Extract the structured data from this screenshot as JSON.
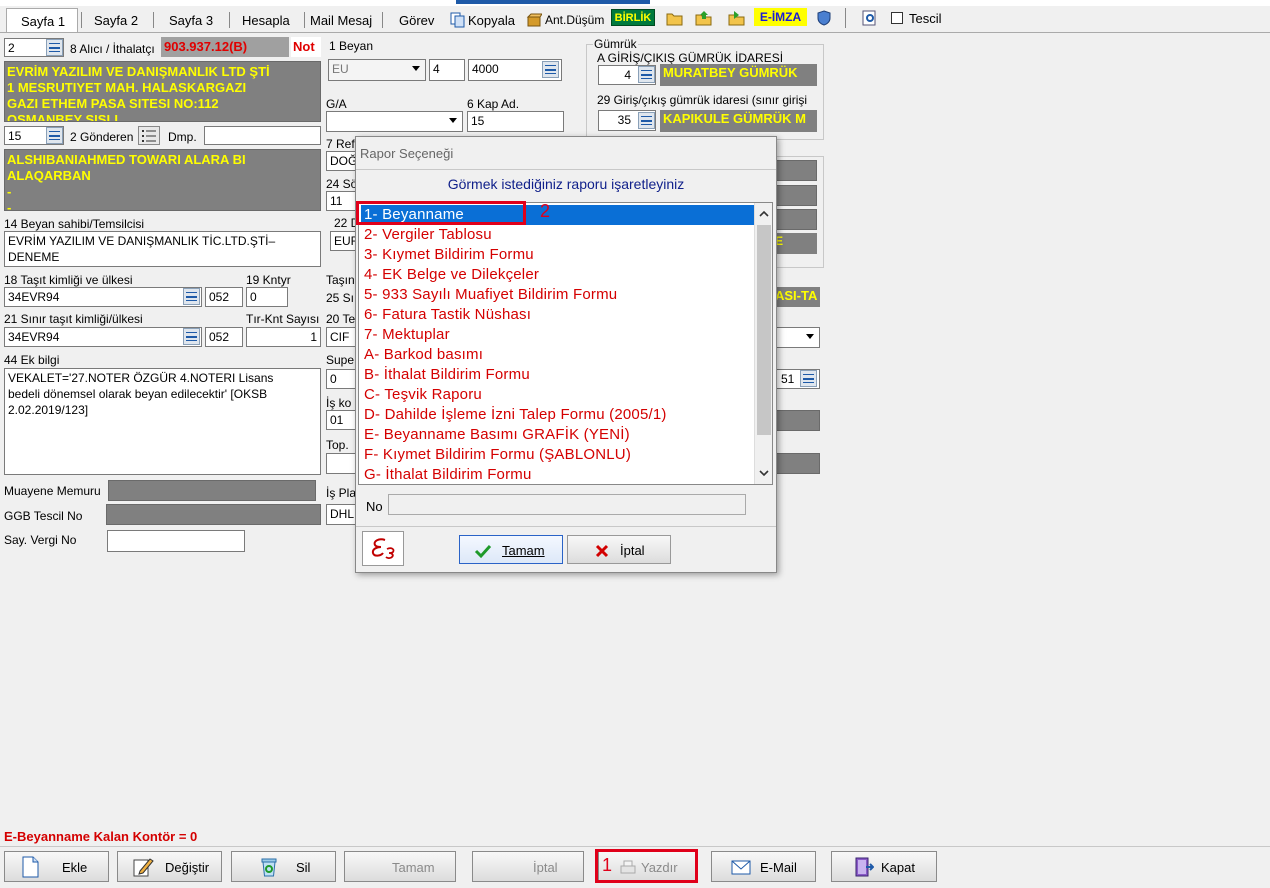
{
  "tabs": {
    "sayfa1": "Sayfa 1",
    "sayfa2": "Sayfa 2",
    "sayfa3": "Sayfa 3",
    "hesapla": "Hesapla",
    "mail": "Mail Mesaj",
    "gorev": "Görev",
    "kopyala": "Kopyala",
    "ant": "Ant.Düşüm",
    "birlik": "BİRLİK",
    "eimza": "E-İMZA",
    "tescil": "Tescil"
  },
  "left": {
    "alici_no": "2",
    "alici_label": "8 Alıcı / İthalatçı",
    "alici_code": "903.937.12(B)",
    "not_label": "Not",
    "alici_lines": [
      "EVRİM YAZILIM VE DANIŞMANLIK LTD ŞTİ",
      "1 MESRUTIYET MAH. HALASKARGAZI",
      "GAZI ETHEM PASA SITESI NO:112",
      "OSMANBEY SISLI"
    ],
    "gonderen_no": "15",
    "gonderen_label": "2 Gönderen",
    "dmp_label": "Dmp.",
    "gonderen_lines": [
      "ALSHIBANIAHMED TOWARI  ALARA BI",
      "ALAQARBAN",
      "-",
      "-"
    ],
    "beyan_sahibi_label": "14 Beyan sahibi/Temsilcisi",
    "beyan_sahibi_lines": [
      "EVRİM YAZILIM VE DANIŞMANLIK TİC.LTD.ŞTİ–",
      "DENEME"
    ],
    "tasit_label": "18 Taşıt kimliği ve ülkesi",
    "kntyr_label": "19 Kntyr",
    "tasit_value": "34EVR94",
    "tasit_country": "052",
    "kntyr_value": "0",
    "sinir_tasit_label": "21 Sınır taşıt kimliği/ülkesi",
    "tir_label": "Tır-Knt Sayısı",
    "sinir_tasit_value": "34EVR94",
    "sinir_tasit_country": "052",
    "tir_value": "1",
    "ek_bilgi_label": "44 Ek bilgi",
    "ek_bilgi_lines": [
      "VEKALET='27.NOTER ÖZGÜR 4.NOTERI Lisans",
      "bedeli dönemsel olarak beyan edilecektir' [OKSB",
      "2.02.2019/123]"
    ],
    "muayene_label": "Muayene Memuru",
    "ggb_label": "GGB Tescil No",
    "vergi_label": "Say. Vergi No"
  },
  "middle": {
    "beyan_label": "1 Beyan",
    "beyan_type": "EU",
    "beyan_no": "4",
    "beyan_code": "4000",
    "ga_label": "G/A",
    "kap_label": "6 Kap Ad.",
    "kap_value": "15",
    "ref_label": "7 Ref",
    "ref_value": "DOĞ",
    "sa_label": "24 Sö",
    "sa_value": "11",
    "d22_label": "22 D",
    "d22_value": "EUF",
    "tasi_label": "Taşın",
    "s25_label": "25 Sı",
    "t20_label": "20 Te",
    "t20_value": "CIF",
    "supe_label": "Supe",
    "supe_value": "0",
    "is_label": "İş ko",
    "is_value": "01",
    "top_label": "Top.",
    "ispla_label": "İş Pla",
    "ispla_value": "DHL"
  },
  "right": {
    "gumruk_label": "Gümrük",
    "giris_label": "A GİRİŞ/ÇIKIŞ GÜMRÜK İDARESİ",
    "giris_no": "4",
    "giris_name": "MURATBEY GÜMRÜK",
    "sinir_label": "29 Giriş/çıkış gümrük idaresi (sınır girişi",
    "sinir_no": "35",
    "sinir_name": "KAPIKULE GÜMRÜK M",
    "e_frag": "E",
    "asi_frag": "ASI-TA",
    "num51": "51"
  },
  "dialog": {
    "title": "Rapor Seçeneği",
    "heading": "Görmek istediğiniz raporu işaretleyiniz",
    "items": [
      "1- Beyanname",
      "2- Vergiler Tablosu",
      "3- Kıymet Bildirim Formu",
      "4- EK Belge ve Dilekçeler",
      "5- 933 Sayılı Muafiyet Bildirim Formu",
      "6- Fatura Tastik Nüshası",
      "7- Mektuplar",
      "A- Barkod basımı",
      "B- İthalat Bildirim Formu",
      "C- Teşvik Raporu",
      "D- Dahilde İşleme İzni Talep Formu (2005/1)",
      "E- Beyanname Basımı GRAFİK (YENİ)",
      "F- Kıymet Bildirim Formu (ŞABLONLU)",
      "G- İthalat Bildirim Formu"
    ],
    "no_label": "No",
    "ok": "Tamam",
    "cancel": "İptal",
    "callout": "2"
  },
  "footer": {
    "kontor": "E-Beyanname Kalan Kontör = 0",
    "ekle": "Ekle",
    "degistir": "Değiştir",
    "sil": "Sil",
    "tamam": "Tamam",
    "iptal": "İptal",
    "yazdir": "Yazdır",
    "email": "E-Mail",
    "kapat": "Kapat",
    "callout": "1"
  }
}
